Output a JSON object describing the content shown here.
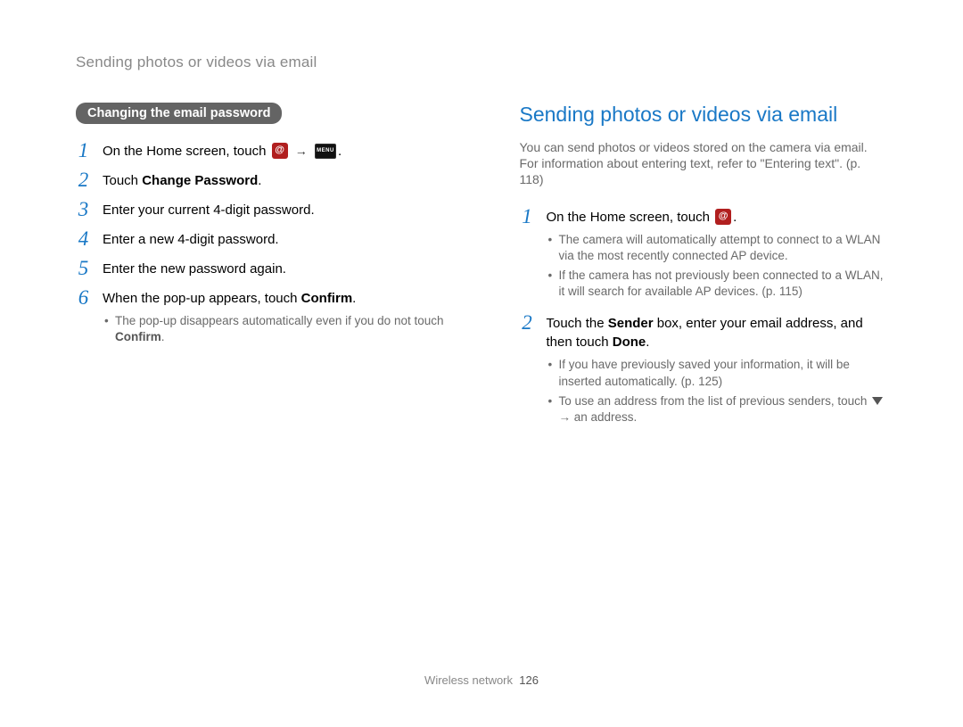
{
  "header": {
    "title": "Sending photos or videos via email"
  },
  "left": {
    "section_tag": "Changing the email password",
    "steps": {
      "s1_pre": "On the Home screen, touch ",
      "s1_mid_arrow": "→",
      "s1_menu": "MENU",
      "s1_end": ".",
      "s2_pre": "Touch ",
      "s2_bold": "Change Password",
      "s2_end": ".",
      "s3": "Enter your current 4-digit password.",
      "s4": "Enter a new 4-digit password.",
      "s5": "Enter the new password again.",
      "s6_pre": "When the pop-up appears, touch ",
      "s6_bold": "Confirm",
      "s6_end": ".",
      "s6_b1_pre": "The pop-up disappears automatically even if you do not touch ",
      "s6_b1_bold": "Confirm",
      "s6_b1_end": "."
    }
  },
  "right": {
    "title": "Sending photos or videos via email",
    "intro": "You can send photos or videos stored on the camera via email. For information about entering text, refer to \"Entering text\". (p. 118)",
    "steps": {
      "s1_pre": "On the Home screen, touch ",
      "s1_end": ".",
      "s1_b1": "The camera will automatically attempt to connect to a WLAN via the most recently connected AP device.",
      "s1_b2": "If the camera has not previously been connected to a WLAN, it will search for available AP devices. (p. 115)",
      "s2_pre": "Touch the ",
      "s2_bold1": "Sender",
      "s2_mid": " box, enter your email address, and then touch ",
      "s2_bold2": "Done",
      "s2_end": ".",
      "s2_b1": "If you have previously saved your information, it will be inserted automatically. (p. 125)",
      "s2_b2_pre": "To use an address from the list of previous senders, touch ",
      "s2_b2_arrow": "→",
      "s2_b2_end": " an address."
    }
  },
  "footer": {
    "section": "Wireless network",
    "page_number": "126"
  }
}
